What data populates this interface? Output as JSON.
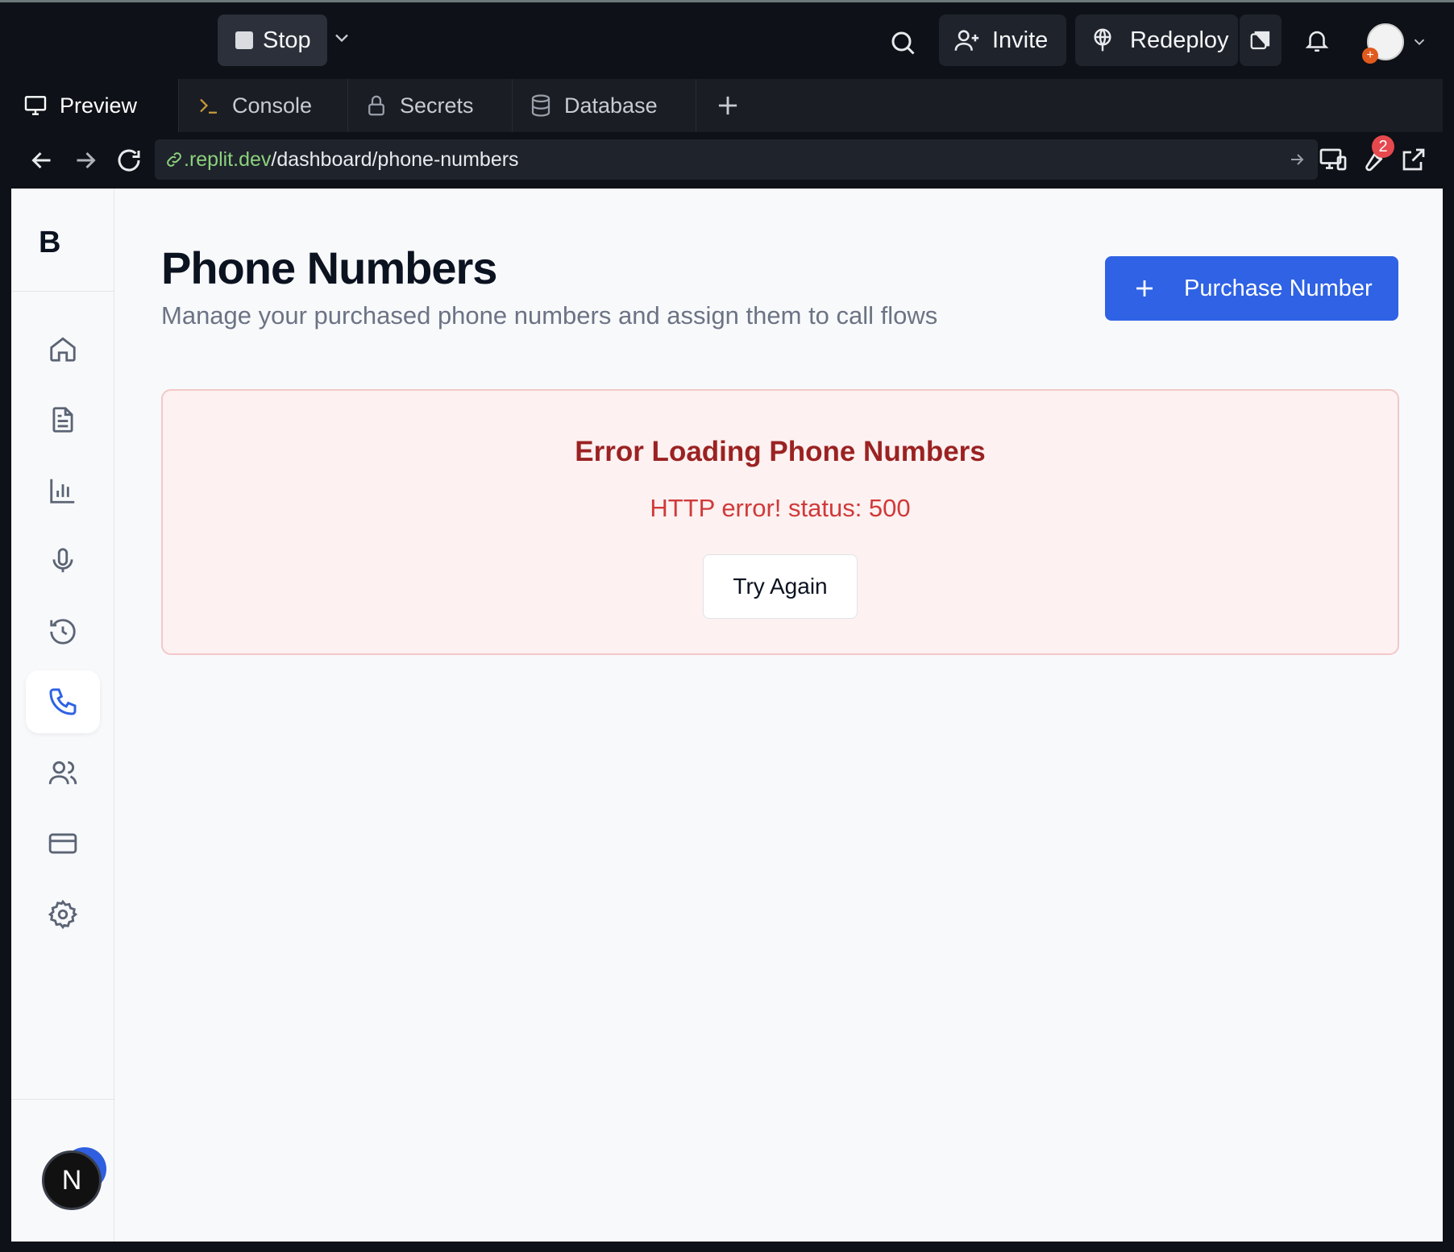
{
  "toolbar": {
    "stop_label": "Stop",
    "invite_label": "Invite",
    "redeploy_label": "Redeploy",
    "notification_icon": "bell-icon",
    "search_icon": "search-icon"
  },
  "tabs": [
    {
      "label": "Preview",
      "icon": "monitor-icon",
      "active": true
    },
    {
      "label": "Console",
      "icon": "terminal-icon",
      "active": false
    },
    {
      "label": "Secrets",
      "icon": "lock-icon",
      "active": false
    },
    {
      "label": "Database",
      "icon": "database-icon",
      "active": false
    }
  ],
  "url": {
    "domain": ".replit.dev",
    "path": "/dashboard/phone-numbers"
  },
  "devtools_badge": "2",
  "sidebar": {
    "logo": "B",
    "items": [
      {
        "icon": "home-icon",
        "active": false
      },
      {
        "icon": "document-icon",
        "active": false
      },
      {
        "icon": "bar-chart-icon",
        "active": false
      },
      {
        "icon": "microphone-icon",
        "active": false
      },
      {
        "icon": "history-icon",
        "active": false
      },
      {
        "icon": "phone-icon",
        "active": true
      },
      {
        "icon": "users-icon",
        "active": false
      },
      {
        "icon": "credit-card-icon",
        "active": false
      },
      {
        "icon": "settings-icon",
        "active": false
      }
    ],
    "avatar_letter": "N"
  },
  "main": {
    "title": "Phone Numbers",
    "subtitle": "Manage your purchased phone numbers and assign them to call flows",
    "purchase_label": "Purchase Number"
  },
  "error": {
    "title": "Error Loading Phone Numbers",
    "message": "HTTP error! status: 500",
    "retry_label": "Try Again"
  },
  "colors": {
    "accent": "#2f62e4",
    "error_text": "#9b2222",
    "error_bg": "#fdf1f1",
    "url_domain": "#8bd17c"
  }
}
